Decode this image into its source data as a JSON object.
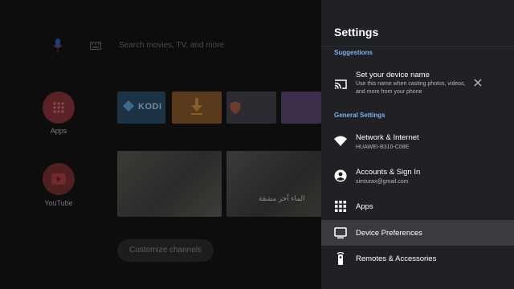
{
  "launcher": {
    "search_placeholder": "Search movies, TV, and more",
    "apps_label": "Apps",
    "youtube_label": "YouTube",
    "kodi_label": "KODI",
    "photo_caption": "الماء آخر مشقة",
    "customize_label": "Customize channels"
  },
  "settings": {
    "title": "Settings",
    "suggestions_header": "Suggestions",
    "suggestion": {
      "title": "Set your device name",
      "subtitle": "Use this name when casting photos, videos, and more from your phone",
      "icon": "cast-icon"
    },
    "general_header": "General Settings",
    "items": [
      {
        "title": "Network & Internet",
        "subtitle": "HUAWEI-B310-C08E",
        "icon": "wifi-icon"
      },
      {
        "title": "Accounts & Sign In",
        "subtitle": "simturax@gmail.com",
        "icon": "account-icon"
      },
      {
        "title": "Apps",
        "subtitle": "",
        "icon": "apps-grid-icon"
      },
      {
        "title": "Device Preferences",
        "subtitle": "",
        "icon": "tv-icon"
      },
      {
        "title": "Remotes & Accessories",
        "subtitle": "",
        "icon": "remote-icon"
      }
    ]
  },
  "colors": {
    "panel_bg": "#202124",
    "section_header": "#7fb0ef",
    "selected_row": "#3a3b3f"
  }
}
